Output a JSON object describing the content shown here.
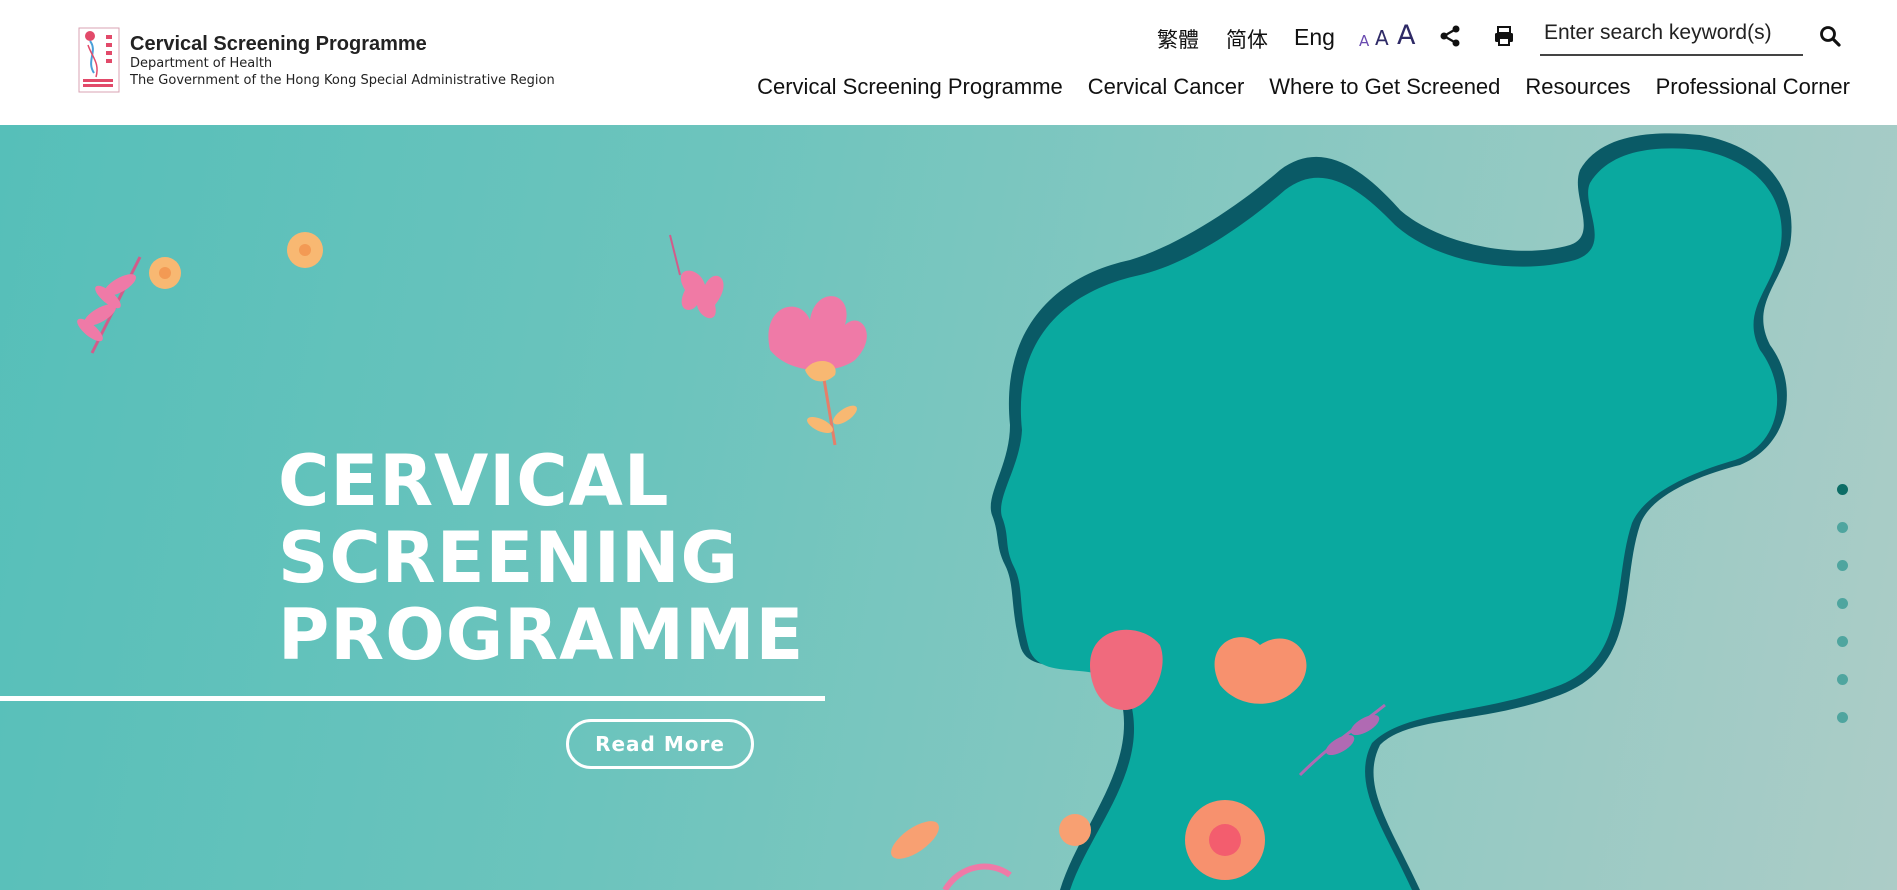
{
  "header": {
    "logo_title": "Cervical Screening Programme",
    "logo_dept": "Department of Health",
    "logo_gov": "The Government of the Hong Kong Special Administrative Region",
    "languages": {
      "tc": "繁體",
      "sc": "简体",
      "en": "Eng"
    },
    "font_sizes": {
      "small": "A",
      "medium": "A",
      "large": "A"
    },
    "icons": {
      "share": "share-icon",
      "print": "print-icon",
      "search": "search-icon"
    },
    "search_placeholder": "Enter search keyword(s)",
    "nav": [
      "Cervical Screening Programme",
      "Cervical Cancer",
      "Where to Get Screened",
      "Resources",
      "Professional Corner"
    ]
  },
  "hero": {
    "title_lines": [
      "CERVICAL",
      "SCREENING",
      "PROGRAMME"
    ],
    "read_more": "Read More",
    "slide_count": 7,
    "active_slide": 1
  },
  "colors": {
    "hero_teal": "#56bfb9",
    "silhouette": "#0aa99f",
    "active_dot": "#0d6d66",
    "flower_pink": "#f07aa5",
    "flower_orange": "#f7b26a"
  }
}
